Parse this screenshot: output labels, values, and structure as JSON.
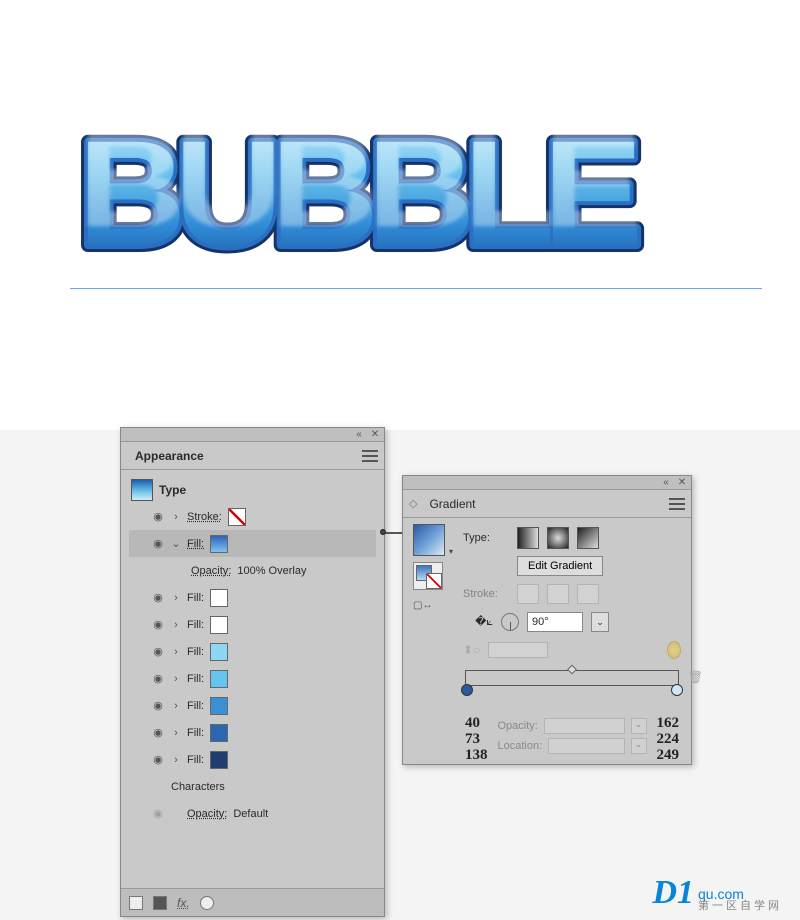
{
  "canvas": {
    "text": "BUBBLE"
  },
  "appearance": {
    "title": "Appearance",
    "type_label": "Type",
    "rows": [
      {
        "label": "Stroke:",
        "swatch": "none"
      },
      {
        "label": "Fill:",
        "swatch": "grad",
        "expanded": true
      },
      {
        "label": "Opacity:",
        "value": "100% Overlay",
        "sub": true
      },
      {
        "label": "Fill:",
        "swatch": "white"
      },
      {
        "label": "Fill:",
        "swatch": "white"
      },
      {
        "label": "Fill:",
        "swatch": "lightblue1"
      },
      {
        "label": "Fill:",
        "swatch": "lightblue2"
      },
      {
        "label": "Fill:",
        "swatch": "blue1"
      },
      {
        "label": "Fill:",
        "swatch": "blue2"
      },
      {
        "label": "Fill:",
        "swatch": "navy"
      }
    ],
    "characters_label": "Characters",
    "opacity_label": "Opacity:",
    "opacity_value": "Default"
  },
  "gradient": {
    "title": "Gradient",
    "type_label": "Type:",
    "edit_button": "Edit Gradient",
    "stroke_label": "Stroke:",
    "angle_value": "90°",
    "opacity_label": "Opacity:",
    "location_label": "Location:",
    "stop_left_rgb": {
      "r": "40",
      "g": "73",
      "b": "138"
    },
    "stop_right_rgb": {
      "r": "162",
      "g": "224",
      "b": "249"
    }
  },
  "watermark": {
    "logo": "D1",
    "domain": "qu.com",
    "sub": "第一区自学网"
  }
}
